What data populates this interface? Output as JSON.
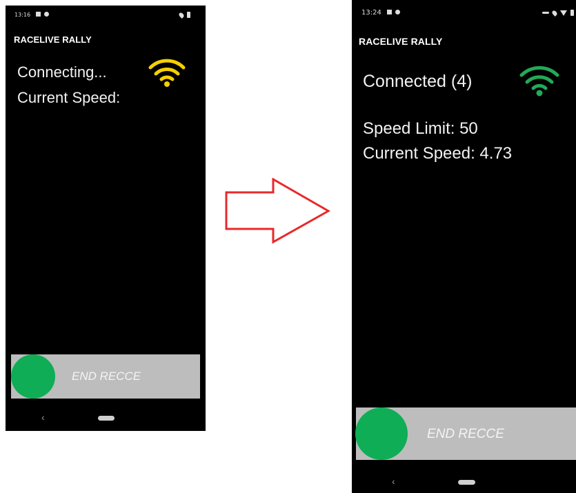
{
  "colors": {
    "phone_bg": "#000000",
    "wifi_connecting": "#f5d000",
    "wifi_connected": "#23a957",
    "slider_track": "#bdbdbd",
    "slider_knob": "#0fad55",
    "arrow": "#e8282b"
  },
  "before": {
    "status_time": "13:16",
    "app_title": "RACELIVE RALLY",
    "connection_text": "Connecting...",
    "wifi_icon": "wifi-icon",
    "current_speed_line": "Current Speed:",
    "slider_label": "END RECCE",
    "nav_back": "‹"
  },
  "after": {
    "status_time": "13:24",
    "app_title": "RACELIVE RALLY",
    "connection_text": "Connected (4)",
    "wifi_icon": "wifi-icon",
    "speed_limit_line": "Speed Limit: 50",
    "current_speed_line": "Current Speed: 4.73",
    "slider_label": "END RECCE",
    "nav_back": "‹"
  },
  "transition_icon": "arrow-right-icon"
}
